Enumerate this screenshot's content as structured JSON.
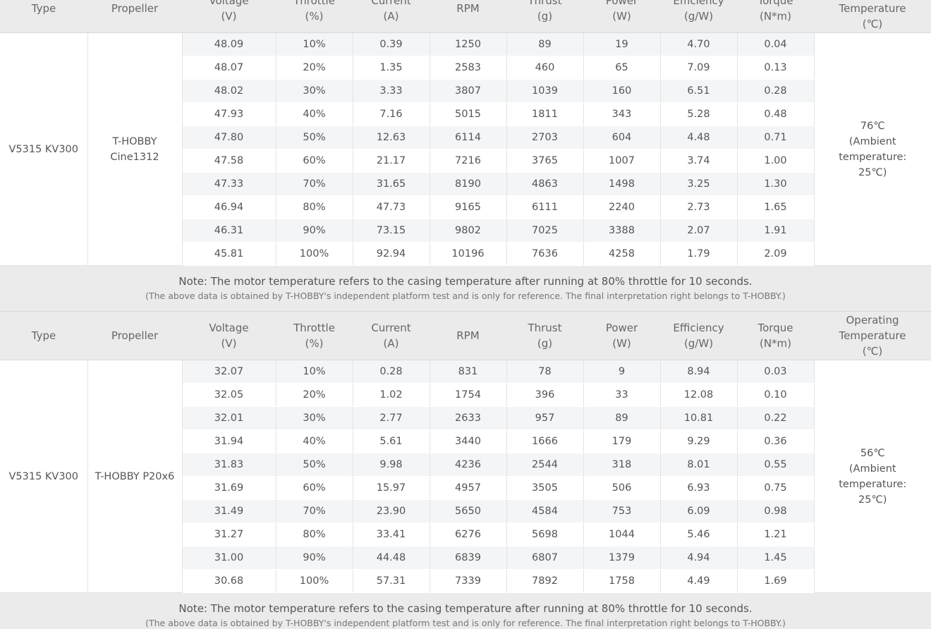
{
  "headers": [
    "Type",
    "Propeller",
    "Voltage",
    "(V)",
    "Throttle",
    "(%)",
    "Current",
    "(A)",
    "RPM",
    "Thrust",
    "(g)",
    "Power",
    "(W)",
    "Efficiency",
    "(g/W)",
    "Torque",
    "(N*m)",
    "Operating",
    "Temperature",
    "(℃)"
  ],
  "note": {
    "main": "Note: The motor temperature refers to the casing temperature after running at 80% throttle for 10 seconds.",
    "sub": "(The above data is obtained by T-HOBBY's independent platform test and is only for reference. The final interpretation right belongs to T-HOBBY.)"
  },
  "tables": [
    {
      "type": "V5315 KV300",
      "propeller": [
        "T-HOBBY",
        "Cine1312"
      ],
      "temperature": [
        "76℃",
        "(Ambient",
        "temperature:",
        "25℃)"
      ],
      "rows": [
        [
          "48.09",
          "10%",
          "0.39",
          "1250",
          "89",
          "19",
          "4.70",
          "0.04"
        ],
        [
          "48.07",
          "20%",
          "1.35",
          "2583",
          "460",
          "65",
          "7.09",
          "0.13"
        ],
        [
          "48.02",
          "30%",
          "3.33",
          "3807",
          "1039",
          "160",
          "6.51",
          "0.28"
        ],
        [
          "47.93",
          "40%",
          "7.16",
          "5015",
          "1811",
          "343",
          "5.28",
          "0.48"
        ],
        [
          "47.80",
          "50%",
          "12.63",
          "6114",
          "2703",
          "604",
          "4.48",
          "0.71"
        ],
        [
          "47.58",
          "60%",
          "21.17",
          "7216",
          "3765",
          "1007",
          "3.74",
          "1.00"
        ],
        [
          "47.33",
          "70%",
          "31.65",
          "8190",
          "4863",
          "1498",
          "3.25",
          "1.30"
        ],
        [
          "46.94",
          "80%",
          "47.73",
          "9165",
          "6111",
          "2240",
          "2.73",
          "1.65"
        ],
        [
          "46.31",
          "90%",
          "73.15",
          "9802",
          "7025",
          "3388",
          "2.07",
          "1.91"
        ],
        [
          "45.81",
          "100%",
          "92.94",
          "10196",
          "7636",
          "4258",
          "1.79",
          "2.09"
        ]
      ]
    },
    {
      "type": "V5315 KV300",
      "propeller": [
        "T-HOBBY P20x6",
        ""
      ],
      "temperature": [
        "56℃",
        "(Ambient",
        "temperature:",
        "25℃)"
      ],
      "rows": [
        [
          "32.07",
          "10%",
          "0.28",
          "831",
          "78",
          "9",
          "8.94",
          "0.03"
        ],
        [
          "32.05",
          "20%",
          "1.02",
          "1754",
          "396",
          "33",
          "12.08",
          "0.10"
        ],
        [
          "32.01",
          "30%",
          "2.77",
          "2633",
          "957",
          "89",
          "10.81",
          "0.22"
        ],
        [
          "31.94",
          "40%",
          "5.61",
          "3440",
          "1666",
          "179",
          "9.29",
          "0.36"
        ],
        [
          "31.83",
          "50%",
          "9.98",
          "4236",
          "2544",
          "318",
          "8.01",
          "0.55"
        ],
        [
          "31.69",
          "60%",
          "15.97",
          "4957",
          "3505",
          "506",
          "6.93",
          "0.75"
        ],
        [
          "31.49",
          "70%",
          "23.90",
          "5650",
          "4584",
          "753",
          "6.09",
          "0.98"
        ],
        [
          "31.27",
          "80%",
          "33.41",
          "6276",
          "5698",
          "1044",
          "5.46",
          "1.21"
        ],
        [
          "31.00",
          "90%",
          "44.48",
          "6839",
          "6807",
          "1379",
          "4.94",
          "1.45"
        ],
        [
          "30.68",
          "100%",
          "57.31",
          "7339",
          "7892",
          "1758",
          "4.49",
          "1.69"
        ]
      ]
    }
  ]
}
